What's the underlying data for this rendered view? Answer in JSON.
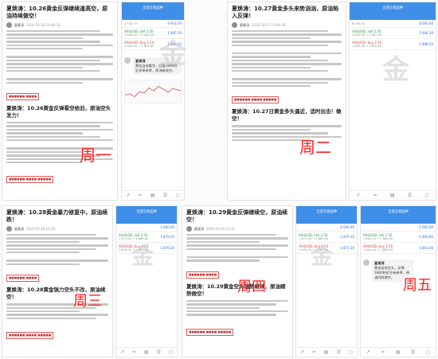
{
  "days": {
    "mon": "周一",
    "tue": "周二",
    "wed": "周三",
    "thu": "周四",
    "fri": "周五"
  },
  "watermark": "金",
  "app": {
    "title": "全部交易品种",
    "status": "",
    "nav": [
      "↗",
      "≈",
      "▤",
      "☰",
      "○"
    ]
  },
  "articles": {
    "a1": {
      "title": "夏焕涛：10.26黄金反弹继续逢高空，原油持续做空！",
      "author": "夏焕涛",
      "date": "2020-10-26 10:49:14",
      "sub": "夏焕涛：10.26黄金反弹看空依旧，原油空头发力！"
    },
    "a2": {
      "title": "夏焕涛：10.27黄金多头来势汹汹，原油陷入反弹！",
      "author": "夏焕涛",
      "date": "2020-10-27 10:46:30",
      "sub": "夏焕涛：10.27日黄金多头逼近，适时出击！做空！"
    },
    "a3": {
      "title": "夏焕涛：10.28黄金暴力修复中，原油续跌！",
      "author": "夏焕涛",
      "date": "2020-10-28 10:28",
      "sub": "夏焕涛：10.28黄金强力空头不改，原油续空！"
    },
    "a4": {
      "title": "夏焕涛：10.29黄金反弹继续空，原油续空！",
      "author": "夏焕涛",
      "date": "2020-10-29 10:31",
      "sub": "夏焕涛：10.29黄金空头强势继续，原油顺势做空！"
    }
  },
  "phones": {
    "p1": {
      "rows": [
        {
          "name": "XAUUSD, sell 2.50",
          "price": "1 905.70",
          "quote": "1 890.00 → 1 900.00"
        },
        {
          "name": "XAUUSD, buy 2.50",
          "price": "1 898.50",
          "quote": "1 892.00 → 1 901.00"
        }
      ],
      "sum": "4 943.79",
      "sum2": "4 943.79",
      "chat": "夏焕涛",
      "chat_text": "黄金当前看空，回落1890附近多单参考，原油继续空。"
    },
    "p2": {
      "rows": [
        {
          "name": "XAUUSD, sell 2.50",
          "price": "1 904.30",
          "quote": "1 891.00 → 1 901.00"
        },
        {
          "name": "XAUUSD, buy 2.50",
          "price": "1 898.50",
          "quote": "1 892.00 → 1 900.00"
        }
      ],
      "sum": "8 000.00",
      "sum2": "8 000.00"
    },
    "p3": {
      "rows": [
        {
          "name": "XAUUSD, sell 2.50",
          "price": "1 879.50",
          "quote": "1 877.00 → 1 866.00"
        },
        {
          "name": "XAUUSD, buy 2.50",
          "price": "1 876.30",
          "quote": "1 876.00 → 1 869.00"
        }
      ],
      "sum": "5 600.00"
    },
    "p4": {
      "rows": [
        {
          "name": "XAUUSD, sell 2.50",
          "price": "1 879.30",
          "quote": "1 877.00 → 1 869.00"
        },
        {
          "name": "XAUUSD, buy 2.50",
          "price": "1 871.30",
          "quote": "1 870.00 → 1 860.00"
        }
      ],
      "sum": "8 000.00"
    },
    "p5": {
      "rows": [
        {
          "name": "XAUUSD, sell 2.50",
          "price": "1 860.90",
          "quote": "1 852.00 → 1 860.00"
        },
        {
          "name": "XAUUSD, buy 2.50",
          "price": "1 861.60",
          "quote": "1 854.00 → 1 864.00"
        }
      ],
      "sum": "5 000.00",
      "chat": "夏焕涛",
      "chat_text": "黄金延续空头，反弹1880附近空单参考，原油同样做空。"
    }
  },
  "colors": {
    "accent": "#3f8ee8",
    "day": "#ff1e1e"
  }
}
